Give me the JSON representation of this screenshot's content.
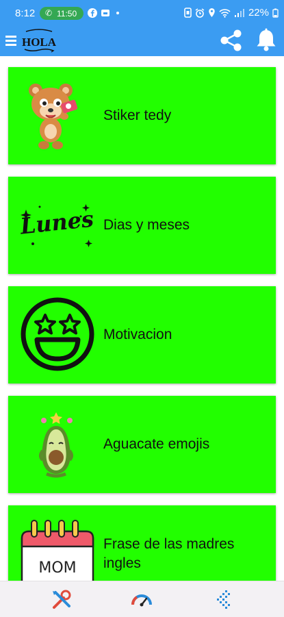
{
  "status": {
    "time": "8:12",
    "call_time": "11:50",
    "battery": "22%"
  },
  "app": {
    "logo_text": "HOLA"
  },
  "items": [
    {
      "label": "Stiker tedy"
    },
    {
      "label": "Dias y meses",
      "thumb_text": "Lunes"
    },
    {
      "label": "Motivacion"
    },
    {
      "label": "Aguacate emojis"
    },
    {
      "label": "Frase de las madres ingles",
      "thumb_text": "MOM"
    }
  ],
  "colors": {
    "appbar": "#3b9cf2",
    "card": "#22ff00",
    "navbar": "#f3f1f4"
  }
}
